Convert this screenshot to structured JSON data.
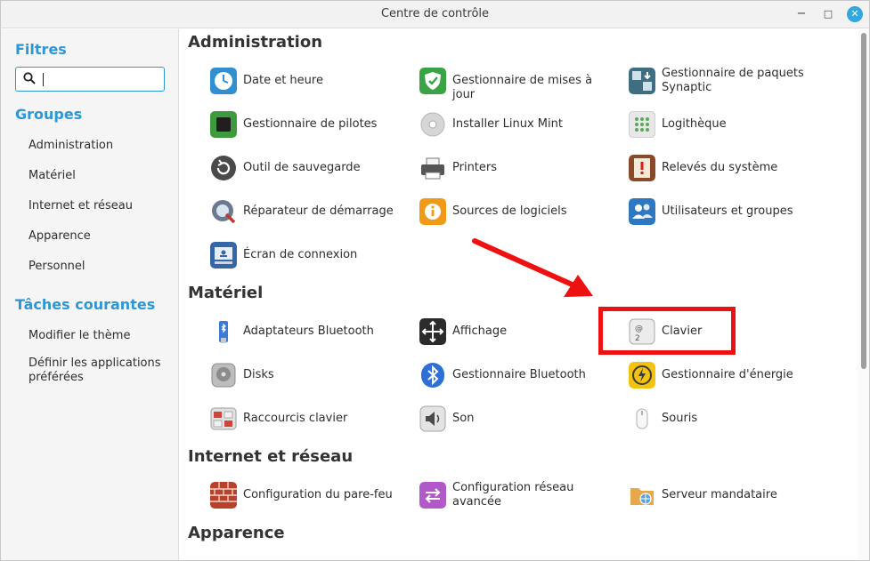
{
  "window": {
    "title": "Centre de contrôle",
    "min": "−",
    "max": "□",
    "close": "✕"
  },
  "sidebar": {
    "filters_title": "Filtres",
    "groups_title": "Groupes",
    "groups": [
      "Administration",
      "Matériel",
      "Internet et réseau",
      "Apparence",
      "Personnel"
    ],
    "tasks_title": "Tâches courantes",
    "tasks": [
      "Modifier le thème",
      "Définir les applications préférées"
    ]
  },
  "sections": {
    "administration": {
      "title": "Administration",
      "items": [
        {
          "label": "Date et heure",
          "icon": "clock-icon",
          "color": "#2f8fd0"
        },
        {
          "label": "Gestionnaire de mises à jour",
          "icon": "shield-icon",
          "color": "#3aa346"
        },
        {
          "label": "Gestionnaire de paquets Synaptic",
          "icon": "package-icon",
          "color": "#3f6e83"
        },
        {
          "label": "Gestionnaire de pilotes",
          "icon": "chip-icon",
          "color": "#3d9b3d"
        },
        {
          "label": "Installer Linux Mint",
          "icon": "disc-icon",
          "color": "#d6d6d6"
        },
        {
          "label": "Logithèque",
          "icon": "apps-grid-icon",
          "color": "#e8e8e8"
        },
        {
          "label": "Outil de sauvegarde",
          "icon": "backup-icon",
          "color": "#4a4a4a"
        },
        {
          "label": "Printers",
          "icon": "printer-icon",
          "color": "#555555"
        },
        {
          "label": "Relevés du système",
          "icon": "report-icon",
          "color": "#8a4a2a"
        },
        {
          "label": "Réparateur de démarrage",
          "icon": "repair-icon",
          "color": "#6b7a8f"
        },
        {
          "label": "Sources de logiciels",
          "icon": "info-icon",
          "color": "#f09a1a"
        },
        {
          "label": "Utilisateurs et groupes",
          "icon": "users-icon",
          "color": "#2e78c2"
        },
        {
          "label": "Écran de connexion",
          "icon": "login-screen-icon",
          "color": "#3567a8"
        }
      ]
    },
    "materiel": {
      "title": "Matériel",
      "items": [
        {
          "label": "Adaptateurs Bluetooth",
          "icon": "usb-bluetooth-icon",
          "color": "#3a7bd5"
        },
        {
          "label": "Affichage",
          "icon": "display-arrows-icon",
          "color": "#2b2b2b"
        },
        {
          "label": "Clavier",
          "icon": "keyboard-key-icon",
          "color": "#e6e6e6"
        },
        {
          "label": "Disks",
          "icon": "disk-icon",
          "color": "#8c8c8c"
        },
        {
          "label": "Gestionnaire Bluetooth",
          "icon": "bluetooth-icon",
          "color": "#2f6fd6"
        },
        {
          "label": "Gestionnaire d'énergie",
          "icon": "energy-icon",
          "color": "#f2c20f"
        },
        {
          "label": "Raccourcis clavier",
          "icon": "shortcuts-icon",
          "color": "#d9d9d9"
        },
        {
          "label": "Son",
          "icon": "speaker-icon",
          "color": "#d0d0d0"
        },
        {
          "label": "Souris",
          "icon": "mouse-icon",
          "color": "#f4f4f4"
        }
      ]
    },
    "internet": {
      "title": "Internet et réseau",
      "items": [
        {
          "label": "Configuration du pare-feu",
          "icon": "firewall-icon",
          "color": "#b8412c"
        },
        {
          "label": "Configuration réseau avancée",
          "icon": "network-arrows-icon",
          "color": "#b259c9"
        },
        {
          "label": "Serveur mandataire",
          "icon": "proxy-folder-icon",
          "color": "#e5a84b"
        }
      ]
    },
    "apparence": {
      "title": "Apparence"
    }
  },
  "annotation": {
    "arrow_color": "#ee1111",
    "box_color": "#ee1111"
  }
}
